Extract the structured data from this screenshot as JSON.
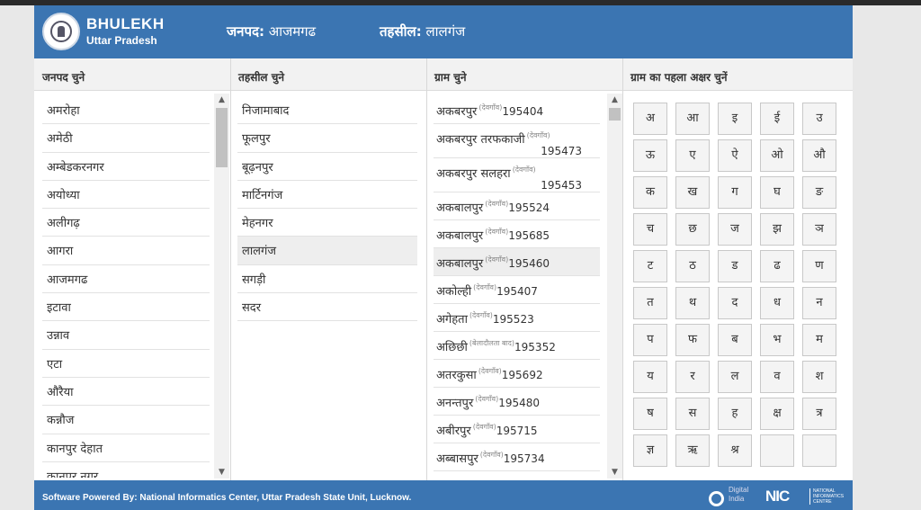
{
  "brand": {
    "title": "BHULEKH",
    "subtitle": "Uttar Pradesh"
  },
  "header": {
    "district_label": "जनपद:",
    "district_value": "आजमगढ",
    "tehsil_label": "तहसील:",
    "tehsil_value": "लालगंज"
  },
  "columns": {
    "district_head": "जनपद चुने",
    "tehsil_head": "तहसील चुने",
    "village_head": "ग्राम चुने",
    "letter_head": "ग्राम का पहला अक्षर चुनें"
  },
  "districts": [
    "अमरोहा",
    "अमेठी",
    "अम्बेडकरनगर",
    "अयोध्या",
    "अलीगढ़",
    "आगरा",
    "आजमगढ",
    "इटावा",
    "उन्नाव",
    "एटा",
    "औरैया",
    "कन्नौज",
    "कानपुर देहात",
    "कानपुर नगर"
  ],
  "tehsils": [
    "निजामाबाद",
    "फूलपुर",
    "बूढ़नपुर",
    "मार्टिनगंज",
    "मेहनगर",
    "लालगंज",
    "सगड़ी",
    "सदर"
  ],
  "selected_tehsil": "लालगंज",
  "villages": [
    {
      "name": "अकबरपुर",
      "tag": "(देवगाँव)",
      "code": "195404"
    },
    {
      "name": "अकबरपुर तरफकाजी",
      "tag": "(देवगाँव)",
      "code": "195473"
    },
    {
      "name": "अकबरपुर सलहरा",
      "tag": "(देवगाँव)",
      "code": "195453"
    },
    {
      "name": "अकबालपुर",
      "tag": "(देवगाँव)",
      "code": "195524"
    },
    {
      "name": "अकबालपुर",
      "tag": "(देवगाँव)",
      "code": "195685"
    },
    {
      "name": "अकबालपुर",
      "tag": "(देवगाँव)",
      "code": "195460"
    },
    {
      "name": "अकोल्ही",
      "tag": "(देवगाँव)",
      "code": "195407"
    },
    {
      "name": "अगेहता",
      "tag": "(देवगाँव)",
      "code": "195523"
    },
    {
      "name": "अछिछी",
      "tag": "(बेलादौलता बाद)",
      "code": "195352"
    },
    {
      "name": "अतरकुसा",
      "tag": "(देवगाँव)",
      "code": "195692"
    },
    {
      "name": "अनन्तपुर",
      "tag": "(देवगाँव)",
      "code": "195480"
    },
    {
      "name": "अबीरपुर",
      "tag": "(देवगाँव)",
      "code": "195715"
    },
    {
      "name": "अब्बासपुर",
      "tag": "(देवगाँव)",
      "code": "195734"
    }
  ],
  "letters": [
    "अ",
    "आ",
    "इ",
    "ई",
    "उ",
    "ऊ",
    "ए",
    "ऐ",
    "ओ",
    "औ",
    "क",
    "ख",
    "ग",
    "घ",
    "ङ",
    "च",
    "छ",
    "ज",
    "झ",
    "ञ",
    "ट",
    "ठ",
    "ड",
    "ढ",
    "ण",
    "त",
    "थ",
    "द",
    "ध",
    "न",
    "प",
    "फ",
    "ब",
    "भ",
    "म",
    "य",
    "र",
    "ल",
    "व",
    "श",
    "ष",
    "स",
    "ह",
    "क्ष",
    "त्र",
    "ज्ञ",
    "ऋ",
    "श्र",
    "",
    ""
  ],
  "footer": {
    "text": "Software Powered By: National Informatics Center, Uttar Pradesh State Unit, Lucknow.",
    "digital_india_line1": "Digital",
    "digital_india_line2": "India",
    "nic_mark": "NIC",
    "nic_sub": "NATIONAL INFORMATICS CENTRE"
  },
  "icons": {
    "scroll_up": "chevron-up-icon",
    "scroll_down": "chevron-down-icon",
    "logo": "up-govt-emblem-icon"
  }
}
